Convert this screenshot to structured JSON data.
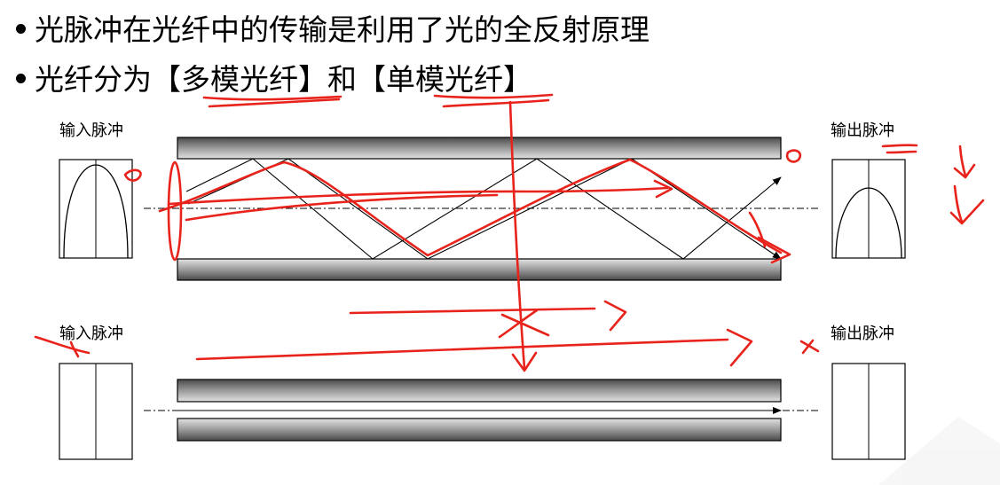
{
  "bullets": [
    {
      "text": "光脉冲在光纤中的传输是利用了光的全反射原理"
    },
    {
      "text_parts": [
        "光纤分为",
        "【",
        "多模光纤",
        "】",
        "和",
        "【",
        "单模光纤",
        "】"
      ]
    }
  ],
  "multimode": {
    "input_label": "输入脉冲",
    "output_label": "输出脉冲"
  },
  "singlemode": {
    "input_label": "输入脉冲",
    "output_label": "输出脉冲"
  },
  "colors": {
    "ink": "#000000",
    "annotation": "#e8231b",
    "cladding_light": "#dcdcdc",
    "cladding_dark": "#4a4a4a"
  }
}
